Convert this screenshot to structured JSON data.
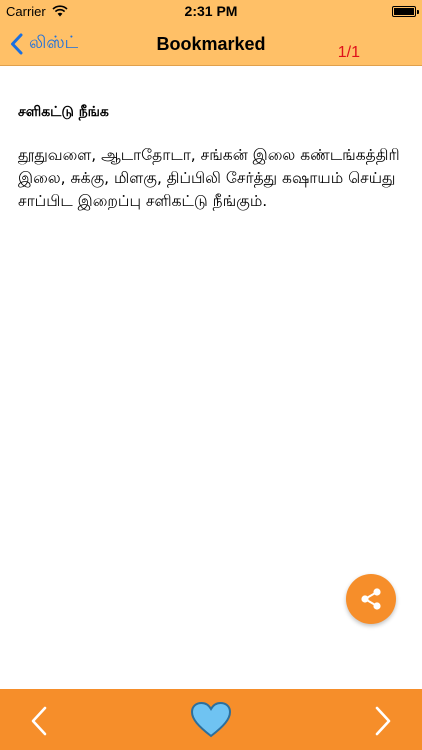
{
  "status_bar": {
    "carrier": "Carrier",
    "time": "2:31 PM"
  },
  "nav": {
    "back_label": "லிஸ்ட்",
    "title": "Bookmarked",
    "page_counter": "1/1"
  },
  "entry": {
    "title": "சளிகட்டு நீங்க",
    "body": "தூதுவளை, ஆடாதோடா, சங்கன் இலை கண்டங்கத்திரி இலை, சுக்கு, மிளகு, திப்பிலி சேர்த்து கஷாயம் செய்து சாப்பிட இறைப்பு சளிகட்டு நீங்கும்."
  },
  "icons": {
    "back": "chevron-left-icon",
    "share": "share-icon",
    "prev": "chevron-left-icon",
    "next": "chevron-right-icon",
    "favorite": "heart-icon",
    "wifi": "wifi-icon",
    "battery": "battery-icon"
  },
  "colors": {
    "nav_background": "#ffc067",
    "bottom_bar": "#f68e2a",
    "share_button": "#f68e2a",
    "back_label": "#1a6fe0",
    "page_counter": "#e0101a",
    "heart_fill": "#6fc3f2"
  }
}
